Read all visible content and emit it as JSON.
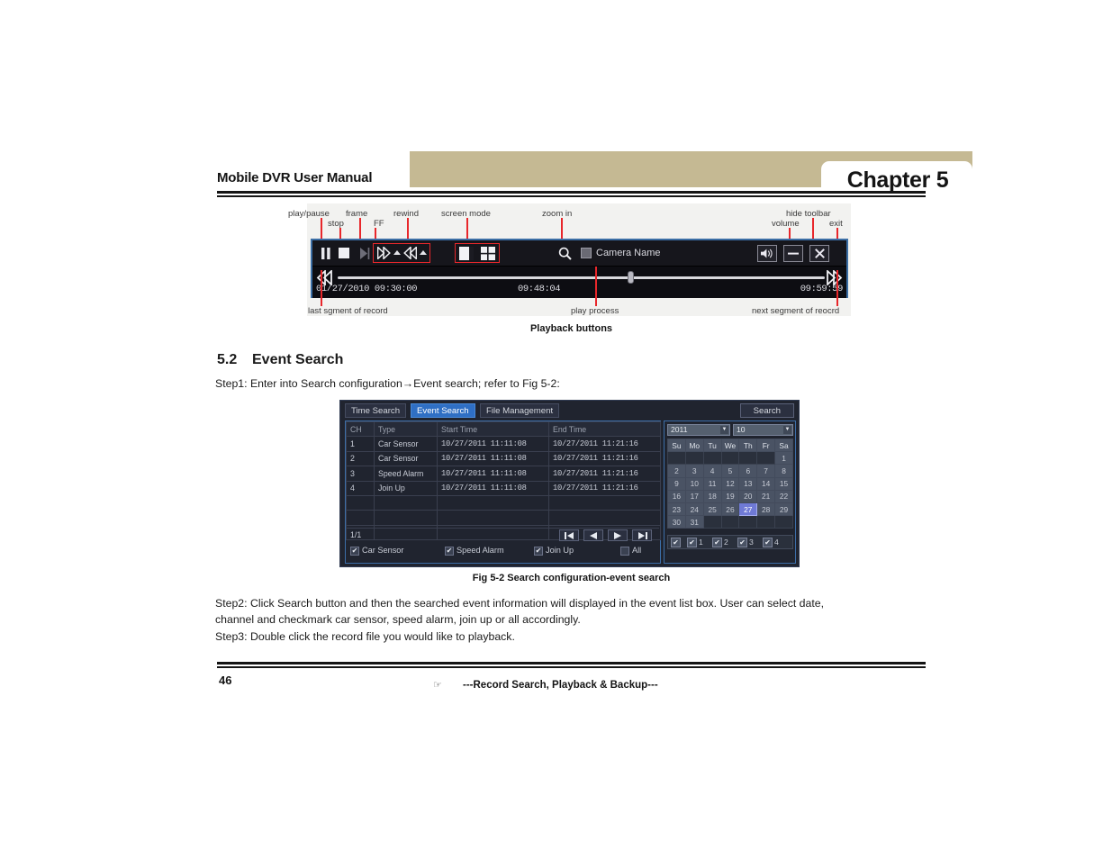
{
  "header": {
    "manual_title": "Mobile DVR User Manual",
    "chapter": "Chapter 5"
  },
  "figure1": {
    "caption": "Playback buttons",
    "annotations_top": [
      {
        "label": "play/pause"
      },
      {
        "label": "stop"
      },
      {
        "label": "frame"
      },
      {
        "label": "FF"
      },
      {
        "label": "rewind"
      },
      {
        "label": "screen mode"
      },
      {
        "label": "zoom in"
      },
      {
        "label": "hide toolbar"
      },
      {
        "label": "volume"
      },
      {
        "label": "exit"
      }
    ],
    "annotations_bottom": [
      {
        "label": "last sgment of record"
      },
      {
        "label": "play process"
      },
      {
        "label": "next segment of reocrd"
      }
    ],
    "toolbar": {
      "pause_icon": "pause-icon",
      "stop_icon": "stop-icon",
      "frame_icon": "frame-step-icon",
      "ff_icon": "fast-forward-icon",
      "ff_up_icon": "ff-speed-up-icon",
      "rewind_icon": "rewind-icon",
      "rewind_up_icon": "rewind-speed-up-icon",
      "single_screen_icon": "single-screen-icon",
      "quad_screen_icon": "quad-screen-icon",
      "zoom_icon": "magnifier-icon",
      "camera_name_checkbox": "camera-name-checkbox",
      "camera_name_label": "Camera Name",
      "volume_icon": "speaker-icon",
      "hide_toolbar_icon": "minimize-icon",
      "exit_icon": "close-icon",
      "prev_segment_icon": "previous-segment-icon",
      "next_segment_icon": "next-segment-icon"
    },
    "timeline": {
      "start_label": "01/27/2010  09:30:00",
      "current_label": "09:48:04",
      "end_label": "09:59:59"
    }
  },
  "section": {
    "number": "5.2",
    "title": "Event Search",
    "step1": "Step1: Enter into Search configuration→Event search; refer to Fig 5-2:",
    "fig_caption": "Fig 5-2 Search configuration-event search",
    "step2_line1": "Step2: Click Search button and then the searched event information will displayed in the event list box. User can select date,",
    "step2_line2": "channel and checkmark car sensor, speed alarm, join up or all accordingly.",
    "step3": "Step3: Double click the record file you would like to playback."
  },
  "dialog": {
    "tabs": [
      {
        "label": "Time Search",
        "active": false
      },
      {
        "label": "Event Search",
        "active": true
      },
      {
        "label": "File Management",
        "active": false
      }
    ],
    "search_button": "Search",
    "table": {
      "headers": [
        "CH",
        "Type",
        "Start Time",
        "End Time"
      ],
      "rows": [
        {
          "ch": "1",
          "type": "Car Sensor",
          "start": "10/27/2011 11:11:08",
          "end": "10/27/2011 11:21:16"
        },
        {
          "ch": "2",
          "type": "Car Sensor",
          "start": "10/27/2011 11:11:08",
          "end": "10/27/2011 11:21:16"
        },
        {
          "ch": "3",
          "type": "Speed Alarm",
          "start": "10/27/2011 11:11:08",
          "end": "10/27/2011 11:21:16"
        },
        {
          "ch": "4",
          "type": "Join Up",
          "start": "10/27/2011 11:11:08",
          "end": "10/27/2011 11:21:16"
        },
        {
          "ch": "",
          "type": "",
          "start": "",
          "end": ""
        },
        {
          "ch": "",
          "type": "",
          "start": "",
          "end": ""
        },
        {
          "ch": "",
          "type": "",
          "start": "",
          "end": ""
        }
      ]
    },
    "pager": {
      "page_label": "1/1",
      "first_icon": "first-page-icon",
      "prev_icon": "previous-page-icon",
      "next_icon": "next-page-icon",
      "last_icon": "last-page-icon"
    },
    "filters": [
      {
        "label": "Car Sensor",
        "checked": true
      },
      {
        "label": "Speed Alarm",
        "checked": true
      },
      {
        "label": "Join Up",
        "checked": true
      },
      {
        "label": "All",
        "checked": false
      }
    ],
    "calendar": {
      "year": "2011",
      "month": "10",
      "weekdays": [
        "Su",
        "Mo",
        "Tu",
        "We",
        "Th",
        "Fr",
        "Sa"
      ],
      "weeks": [
        [
          "",
          "",
          "",
          "",
          "",
          "",
          "1"
        ],
        [
          "2",
          "3",
          "4",
          "5",
          "6",
          "7",
          "8"
        ],
        [
          "9",
          "10",
          "11",
          "12",
          "13",
          "14",
          "15"
        ],
        [
          "16",
          "17",
          "18",
          "19",
          "20",
          "21",
          "22"
        ],
        [
          "23",
          "24",
          "25",
          "26",
          "27",
          "28",
          "29"
        ],
        [
          "30",
          "31",
          "",
          "",
          "",
          "",
          ""
        ]
      ],
      "selected_day": "27"
    },
    "channels": [
      {
        "label": "",
        "checked": true
      },
      {
        "label": "1",
        "checked": true
      },
      {
        "label": "2",
        "checked": true
      },
      {
        "label": "3",
        "checked": true
      },
      {
        "label": "4",
        "checked": true
      }
    ]
  },
  "footer": {
    "page_number": "46",
    "hand_icon": "pointing-hand-icon",
    "text": "---Record Search, Playback & Backup---"
  },
  "colors": {
    "header_band": "#c5b993",
    "accent_blue": "#2f6fc4",
    "annotation_red": "#e8272b",
    "panel_border": "#3c6ea8"
  }
}
